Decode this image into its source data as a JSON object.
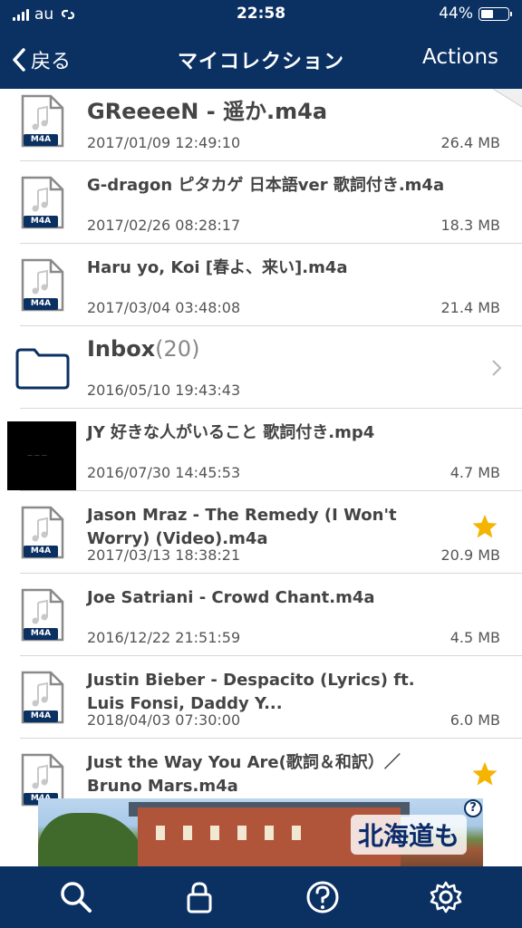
{
  "status": {
    "carrier": "au",
    "time": "22:58",
    "battery": "44%"
  },
  "nav": {
    "back": "戻る",
    "title": "マイコレクション",
    "actions": "Actions"
  },
  "items": [
    {
      "name": "GReeeeN - 遥か.m4a",
      "date": "2017/01/09 12:49:10",
      "size": "26.4 MB",
      "type": "m4a",
      "badge": "M4A"
    },
    {
      "name": "G-dragon ピタカゲ 日本語ver 歌詞付き.m4a",
      "date": "2017/02/26 08:28:17",
      "size": "18.3 MB",
      "type": "m4a",
      "badge": "M4A"
    },
    {
      "name": "Haru yo, Koi [春よ、来い].m4a",
      "date": "2017/03/04 03:48:08",
      "size": "21.4 MB",
      "type": "m4a",
      "badge": "M4A"
    },
    {
      "name": "Inbox",
      "count": "(20)",
      "date": "2016/05/10 19:43:43",
      "type": "folder"
    },
    {
      "name": "JY 好きな人がいること 歌詞付き.mp4",
      "date": "2016/07/30 14:45:53",
      "size": "4.7 MB",
      "type": "video"
    },
    {
      "name": "Jason Mraz - The Remedy (I Won't Worry) (Video).m4a",
      "date": "2017/03/13 18:38:21",
      "size": "20.9 MB",
      "type": "m4a",
      "badge": "M4A",
      "starred": true
    },
    {
      "name": "Joe Satriani - Crowd Chant.m4a",
      "date": "2016/12/22 21:51:59",
      "size": "4.5 MB",
      "type": "m4a",
      "badge": "M4A"
    },
    {
      "name": "Justin Bieber - Despacito (Lyrics) ft. Luis Fonsi, Daddy Y...",
      "date": "2018/04/03 07:30:00",
      "size": "6.0 MB",
      "type": "m4a",
      "badge": "M4A"
    },
    {
      "name": "Just the Way You Are(歌詞＆和訳）／Bruno Mars.m4a",
      "date": "",
      "size": "",
      "type": "m4a",
      "badge": "M4A",
      "starred": true
    }
  ],
  "ad": {
    "text": "北海道も",
    "help": "?"
  },
  "colors": {
    "nav": "#0b3163",
    "star": "#f5b400",
    "text": "#444444"
  },
  "tabs": [
    "search-icon",
    "lock-icon",
    "help-icon",
    "gear-icon"
  ]
}
